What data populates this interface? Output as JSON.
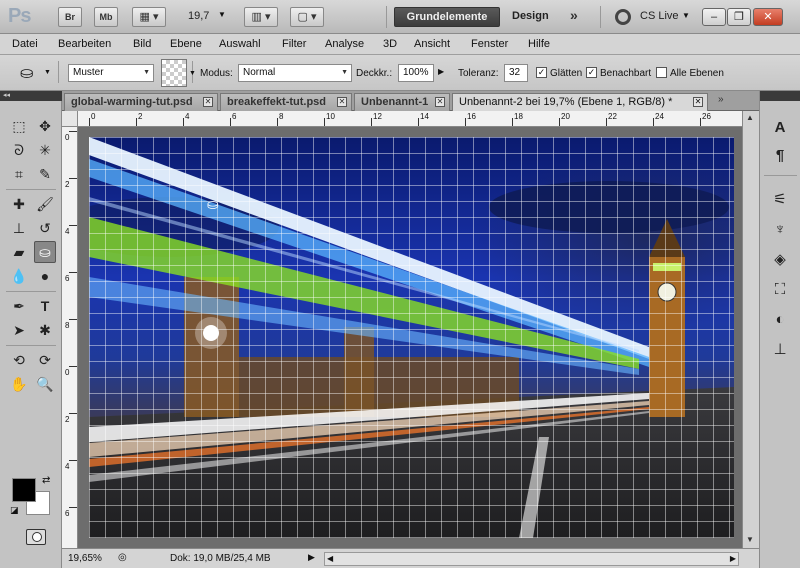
{
  "appbar": {
    "logo": "Ps",
    "bridge_label": "Br",
    "minibridge_label": "Mb",
    "zoom_value": "19,7",
    "workspace_active": "Grundelemente",
    "workspace_design": "Design",
    "more_label": "»",
    "cs_live": "CS Live",
    "minimize": "–",
    "restore": "❐",
    "close": "✕"
  },
  "menu": [
    "Datei",
    "Bearbeiten",
    "Bild",
    "Ebene",
    "Auswahl",
    "Filter",
    "Analyse",
    "3D",
    "Ansicht",
    "Fenster",
    "Hilfe"
  ],
  "options": {
    "source_value": "Muster",
    "mode_label": "Modus:",
    "mode_value": "Normal",
    "opacity_label": "Deckkr.:",
    "opacity_value": "100%",
    "tolerance_label": "Toleranz:",
    "tolerance_value": "32",
    "smooth_label": "Glätten",
    "adjacent_label": "Benachbart",
    "all_layers_label": "Alle Ebenen",
    "smooth_checked": true,
    "adjacent_checked": true,
    "all_layers_checked": false
  },
  "tabs": [
    {
      "label": "global-warming-tut.psd",
      "active": false
    },
    {
      "label": "breakeffekt-tut.psd",
      "active": false
    },
    {
      "label": "Unbenannt-1",
      "active": false
    },
    {
      "label": "Unbenannt-2 bei 19,7% (Ebene 1, RGB/8) *",
      "active": true
    }
  ],
  "ruler_top": [
    "0",
    "2",
    "4",
    "6",
    "8",
    "10",
    "12",
    "14",
    "16",
    "18",
    "20",
    "22",
    "24",
    "26"
  ],
  "ruler_left": [
    "0",
    "2",
    "4",
    "6",
    "8",
    "0",
    "2",
    "4",
    "6"
  ],
  "status": {
    "zoom": "19,65%",
    "doc_info": "Dok: 19,0 MB/25,4 MB"
  },
  "colors": {
    "foreground": "#000000",
    "background": "#ffffff"
  }
}
